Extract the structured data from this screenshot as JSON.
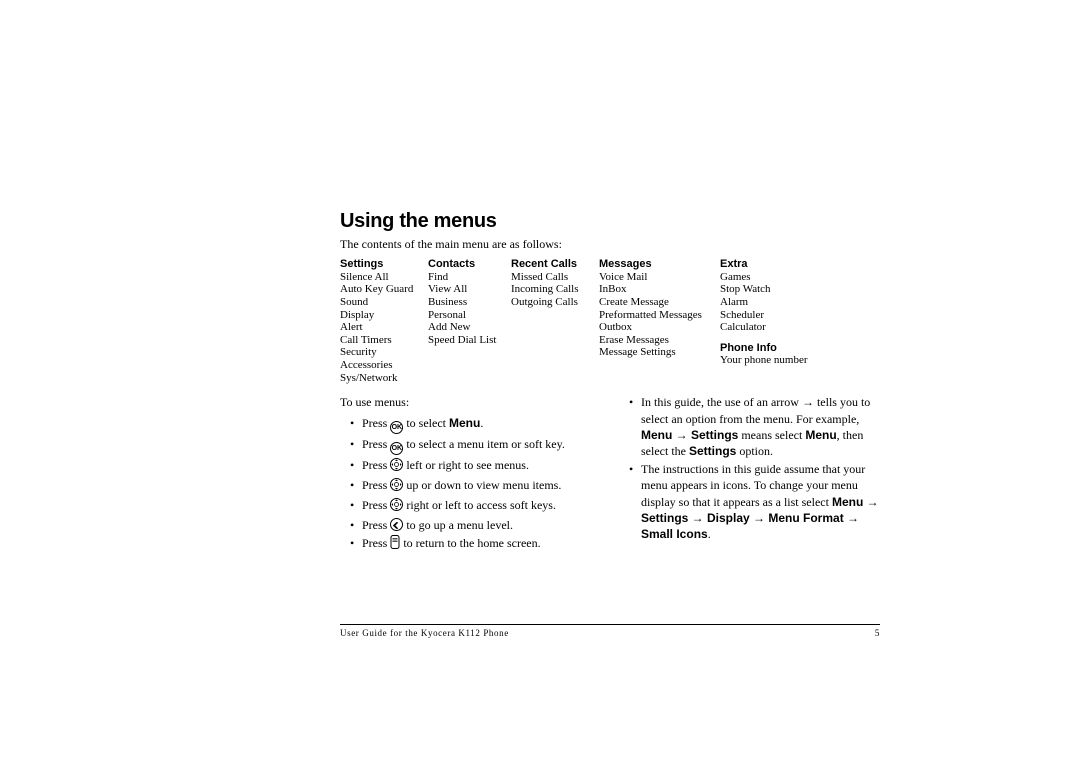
{
  "title": "Using the menus",
  "intro": "The contents of the main menu are as follows:",
  "menus": {
    "settings": {
      "header": "Settings",
      "items": [
        "Silence All",
        "Auto Key Guard",
        "Sound",
        "Display",
        "Alert",
        "Call Timers",
        "Security",
        "Accessories",
        "Sys/Network"
      ]
    },
    "contacts": {
      "header": "Contacts",
      "items": [
        "Find",
        "View All",
        "Business",
        "Personal",
        "Add New",
        "Speed Dial List"
      ]
    },
    "recent_calls": {
      "header": "Recent Calls",
      "items": [
        "Missed Calls",
        "Incoming Calls",
        "Outgoing Calls"
      ]
    },
    "messages": {
      "header": "Messages",
      "items": [
        "Voice Mail",
        "InBox",
        "Create Message",
        "Preformatted Messages",
        "Outbox",
        "Erase Messages",
        "Message Settings"
      ]
    },
    "extra": {
      "header": "Extra",
      "items": [
        "Games",
        "Stop Watch",
        "Alarm",
        "Scheduler",
        "Calculator"
      ]
    },
    "phone_info": {
      "header": "Phone Info",
      "items": [
        "Your phone number"
      ]
    }
  },
  "left_col": {
    "lead": "To use menus:",
    "lines": {
      "l0_pre": "Press ",
      "l0_post": " to select ",
      "l0_bold": "Menu",
      "l0_end": ".",
      "l1_pre": "Press ",
      "l1_post": " to select a menu item or soft key.",
      "l2_pre": "Press ",
      "l2_post": " left or right to see menus.",
      "l3_pre": "Press ",
      "l3_post": " up or down to view menu items.",
      "l4_pre": "Press ",
      "l4_post": " right or left to access soft keys.",
      "l5_pre": "Press ",
      "l5_post": " to go up a menu level.",
      "l6_pre": "Press ",
      "l6_post": " to return to the home screen."
    }
  },
  "right_col": {
    "b0_a": "In this guide, the use of an arrow → tells you to select an option from the menu. For example, ",
    "b0_bold1": "Menu → Settings",
    "b0_b": " means select ",
    "b0_bold2": "Menu",
    "b0_c": ", then select the ",
    "b0_bold3": "Settings",
    "b0_d": " option.",
    "b1_a": "The instructions in this guide assume that your menu appears in icons. To change your menu display so that it appears as a list select ",
    "b1_bold": "Menu → Settings → Display → Menu Format → Small Icons",
    "b1_b": "."
  },
  "footer": {
    "guide": "User Guide for the Kyocera K112 Phone",
    "page": "5"
  }
}
